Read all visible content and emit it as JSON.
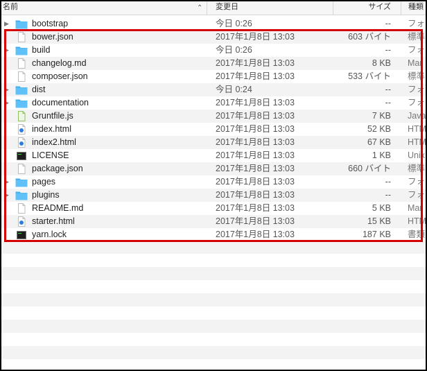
{
  "header": {
    "name": "名前",
    "date": "変更日",
    "size": "サイズ",
    "kind": "種類"
  },
  "colors": {
    "folder": "#41aef2",
    "highlight": "#d40000"
  },
  "files": [
    {
      "name": "bootstrap",
      "date": "今日 0:26",
      "size": "--",
      "kind": "フォ",
      "type": "folder"
    },
    {
      "name": "bower.json",
      "date": "2017年1月8日 13:03",
      "size": "603 バイト",
      "kind": "標準",
      "type": "doc"
    },
    {
      "name": "build",
      "date": "今日 0:26",
      "size": "--",
      "kind": "フォ",
      "type": "folder"
    },
    {
      "name": "changelog.md",
      "date": "2017年1月8日 13:03",
      "size": "8 KB",
      "kind": "Mar",
      "type": "doc"
    },
    {
      "name": "composer.json",
      "date": "2017年1月8日 13:03",
      "size": "533 バイト",
      "kind": "標準",
      "type": "doc"
    },
    {
      "name": "dist",
      "date": "今日 0:24",
      "size": "--",
      "kind": "フォ",
      "type": "folder"
    },
    {
      "name": "documentation",
      "date": "2017年1月8日 13:03",
      "size": "--",
      "kind": "フォ",
      "type": "folder"
    },
    {
      "name": "Gruntfile.js",
      "date": "2017年1月8日 13:03",
      "size": "7 KB",
      "kind": "Java",
      "type": "js"
    },
    {
      "name": "index.html",
      "date": "2017年1月8日 13:03",
      "size": "52 KB",
      "kind": "HTM",
      "type": "html"
    },
    {
      "name": "index2.html",
      "date": "2017年1月8日 13:03",
      "size": "67 KB",
      "kind": "HTM",
      "type": "html"
    },
    {
      "name": "LICENSE",
      "date": "2017年1月8日 13:03",
      "size": "1 KB",
      "kind": "Unix",
      "type": "exec"
    },
    {
      "name": "package.json",
      "date": "2017年1月8日 13:03",
      "size": "660 バイト",
      "kind": "標準",
      "type": "doc"
    },
    {
      "name": "pages",
      "date": "2017年1月8日 13:03",
      "size": "--",
      "kind": "フォ",
      "type": "folder"
    },
    {
      "name": "plugins",
      "date": "2017年1月8日 13:03",
      "size": "--",
      "kind": "フォ",
      "type": "folder"
    },
    {
      "name": "README.md",
      "date": "2017年1月8日 13:03",
      "size": "5 KB",
      "kind": "Mar",
      "type": "doc"
    },
    {
      "name": "starter.html",
      "date": "2017年1月8日 13:03",
      "size": "15 KB",
      "kind": "HTM",
      "type": "html"
    },
    {
      "name": "yarn.lock",
      "date": "2017年1月8日 13:03",
      "size": "187 KB",
      "kind": "書類",
      "type": "exec"
    }
  ]
}
